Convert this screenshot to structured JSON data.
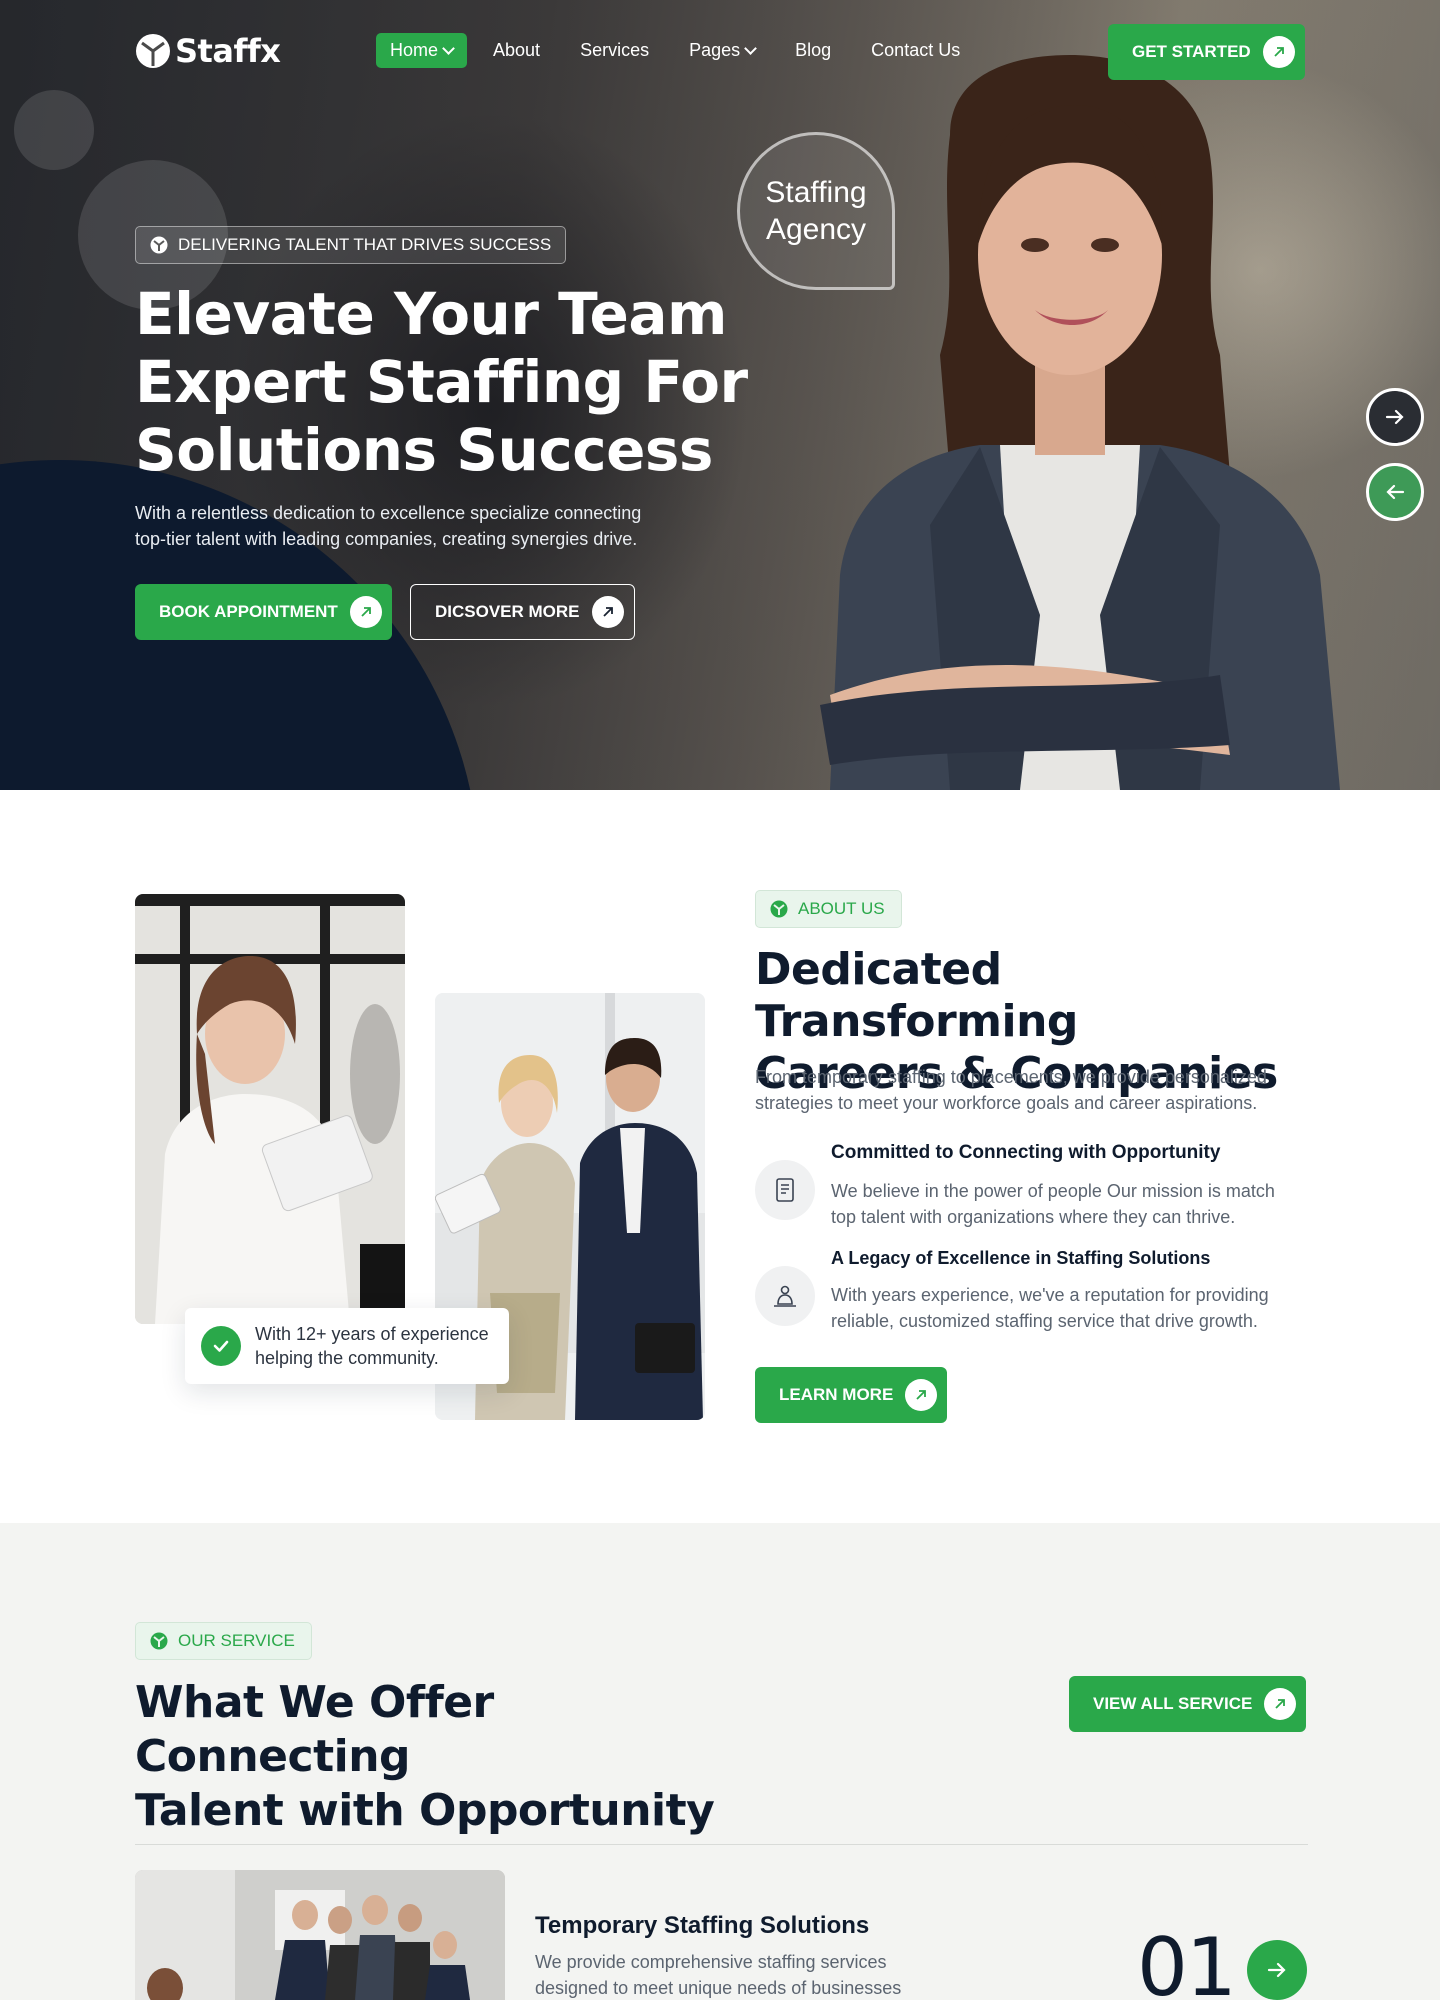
{
  "brand": {
    "name": "Staffx",
    "accent": "#2aa84a",
    "navy": "#0d1a2e"
  },
  "nav": {
    "items": [
      {
        "label": "Home",
        "active": true,
        "dropdown": true
      },
      {
        "label": "About",
        "active": false,
        "dropdown": false
      },
      {
        "label": "Services",
        "active": false,
        "dropdown": false
      },
      {
        "label": "Pages",
        "active": false,
        "dropdown": true
      },
      {
        "label": "Blog",
        "active": false,
        "dropdown": false
      },
      {
        "label": "Contact Us",
        "active": false,
        "dropdown": false
      }
    ],
    "cta": "GET STARTED"
  },
  "hero": {
    "badge": "DELIVERING TALENT THAT DRIVES SUCCESS",
    "title_lines": [
      "Elevate Your Team",
      "Expert Staffing For",
      "Solutions Success"
    ],
    "description_lines": [
      "With a relentless dedication to excellence specialize  connecting",
      "top-tier talent with leading companies, creating synergies drive."
    ],
    "primary_button": "BOOK APPOINTMENT",
    "secondary_button": "DICSOVER MORE",
    "bubble_lines": [
      "Staffing",
      "Agency"
    ]
  },
  "about": {
    "badge": "ABOUT US",
    "title_lines": [
      "Dedicated  Transforming",
      "Careers & Companies"
    ],
    "description_lines": [
      "From temporary staffing to placements, we provide personalized",
      "strategies to meet your workforce goals and career aspirations."
    ],
    "experience_lines": [
      "With 12+ years of experience",
      "helping the community."
    ],
    "features": [
      {
        "title": "Committed to Connecting with Opportunity",
        "description_lines": [
          "We believe in the power of people Our mission is match",
          "top talent with organizations where they can thrive."
        ],
        "icon": "document-icon"
      },
      {
        "title": "A Legacy of Excellence in Staffing Solutions",
        "description_lines": [
          "With years experience, we've a reputation for providing",
          "reliable, customized staffing service that drive growth."
        ],
        "icon": "people-icon"
      }
    ],
    "button": "LEARN MORE"
  },
  "services": {
    "badge": "OUR SERVICE",
    "title_lines": [
      "What We Offer Connecting",
      "Talent with Opportunity"
    ],
    "button": "VIEW ALL SERVICE",
    "items": [
      {
        "number": "01",
        "name": "Temporary Staffing Solutions",
        "description_lines": [
          "We provide comprehensive staffing services",
          "designed to meet unique needs of businesses"
        ]
      }
    ]
  }
}
